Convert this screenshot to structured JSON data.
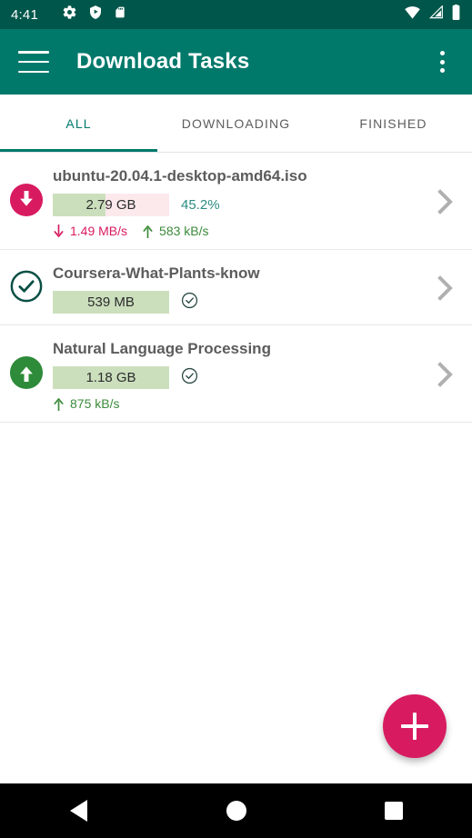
{
  "status_bar": {
    "time": "4:41",
    "left_icons": [
      "gear-icon",
      "shield-play-icon",
      "sd-card-icon"
    ],
    "right_icons": [
      "wifi-icon",
      "cell-signal-icon",
      "battery-icon"
    ],
    "background_color": "#00564a"
  },
  "app_bar": {
    "menu_icon": "hamburger-menu-icon",
    "title": "Download Tasks",
    "overflow_icon": "more-vertical-icon",
    "background_color": "#00796b"
  },
  "tabs": {
    "active_index": 0,
    "accent_color": "#00796b",
    "items": [
      {
        "label": "ALL"
      },
      {
        "label": "DOWNLOADING"
      },
      {
        "label": "FINISHED"
      }
    ]
  },
  "tasks": [
    {
      "status_icon": "download-circle-icon",
      "status_icon_style": "filled-pink",
      "title": "ubuntu-20.04.1-desktop-amd64.iso",
      "size": "2.79 GB",
      "percent_label": "45.2%",
      "percent_value": 45.2,
      "complete_check": false,
      "download_speed": "1.49 MB/s",
      "upload_speed": "583 kB/s",
      "chevron_icon": "chevron-right-icon"
    },
    {
      "status_icon": "check-circle-outline-icon",
      "status_icon_style": "outline-teal",
      "title": "Coursera-What-Plants-know",
      "size": "539 MB",
      "percent_label": "",
      "percent_value": 100,
      "complete_check": true,
      "download_speed": "",
      "upload_speed": "",
      "chevron_icon": "chevron-right-icon"
    },
    {
      "status_icon": "upload-circle-icon",
      "status_icon_style": "filled-green",
      "title": "Natural Language Processing",
      "size": "1.18 GB",
      "percent_label": "",
      "percent_value": 100,
      "complete_check": true,
      "download_speed": "",
      "upload_speed": "875 kB/s",
      "chevron_icon": "chevron-right-icon"
    }
  ],
  "fab": {
    "icon": "plus-icon",
    "color": "#d81b60"
  },
  "nav_bar": {
    "back_icon": "back-triangle-icon",
    "home_icon": "home-circle-icon",
    "recents_icon": "recents-square-icon"
  },
  "colors": {
    "primary": "#00796b",
    "primary_dark": "#00564a",
    "accent_pink": "#d81b60",
    "progress_done": "#cbdfbd",
    "progress_remain": "#fce9ec",
    "upload_green": "#3c8b3c"
  }
}
